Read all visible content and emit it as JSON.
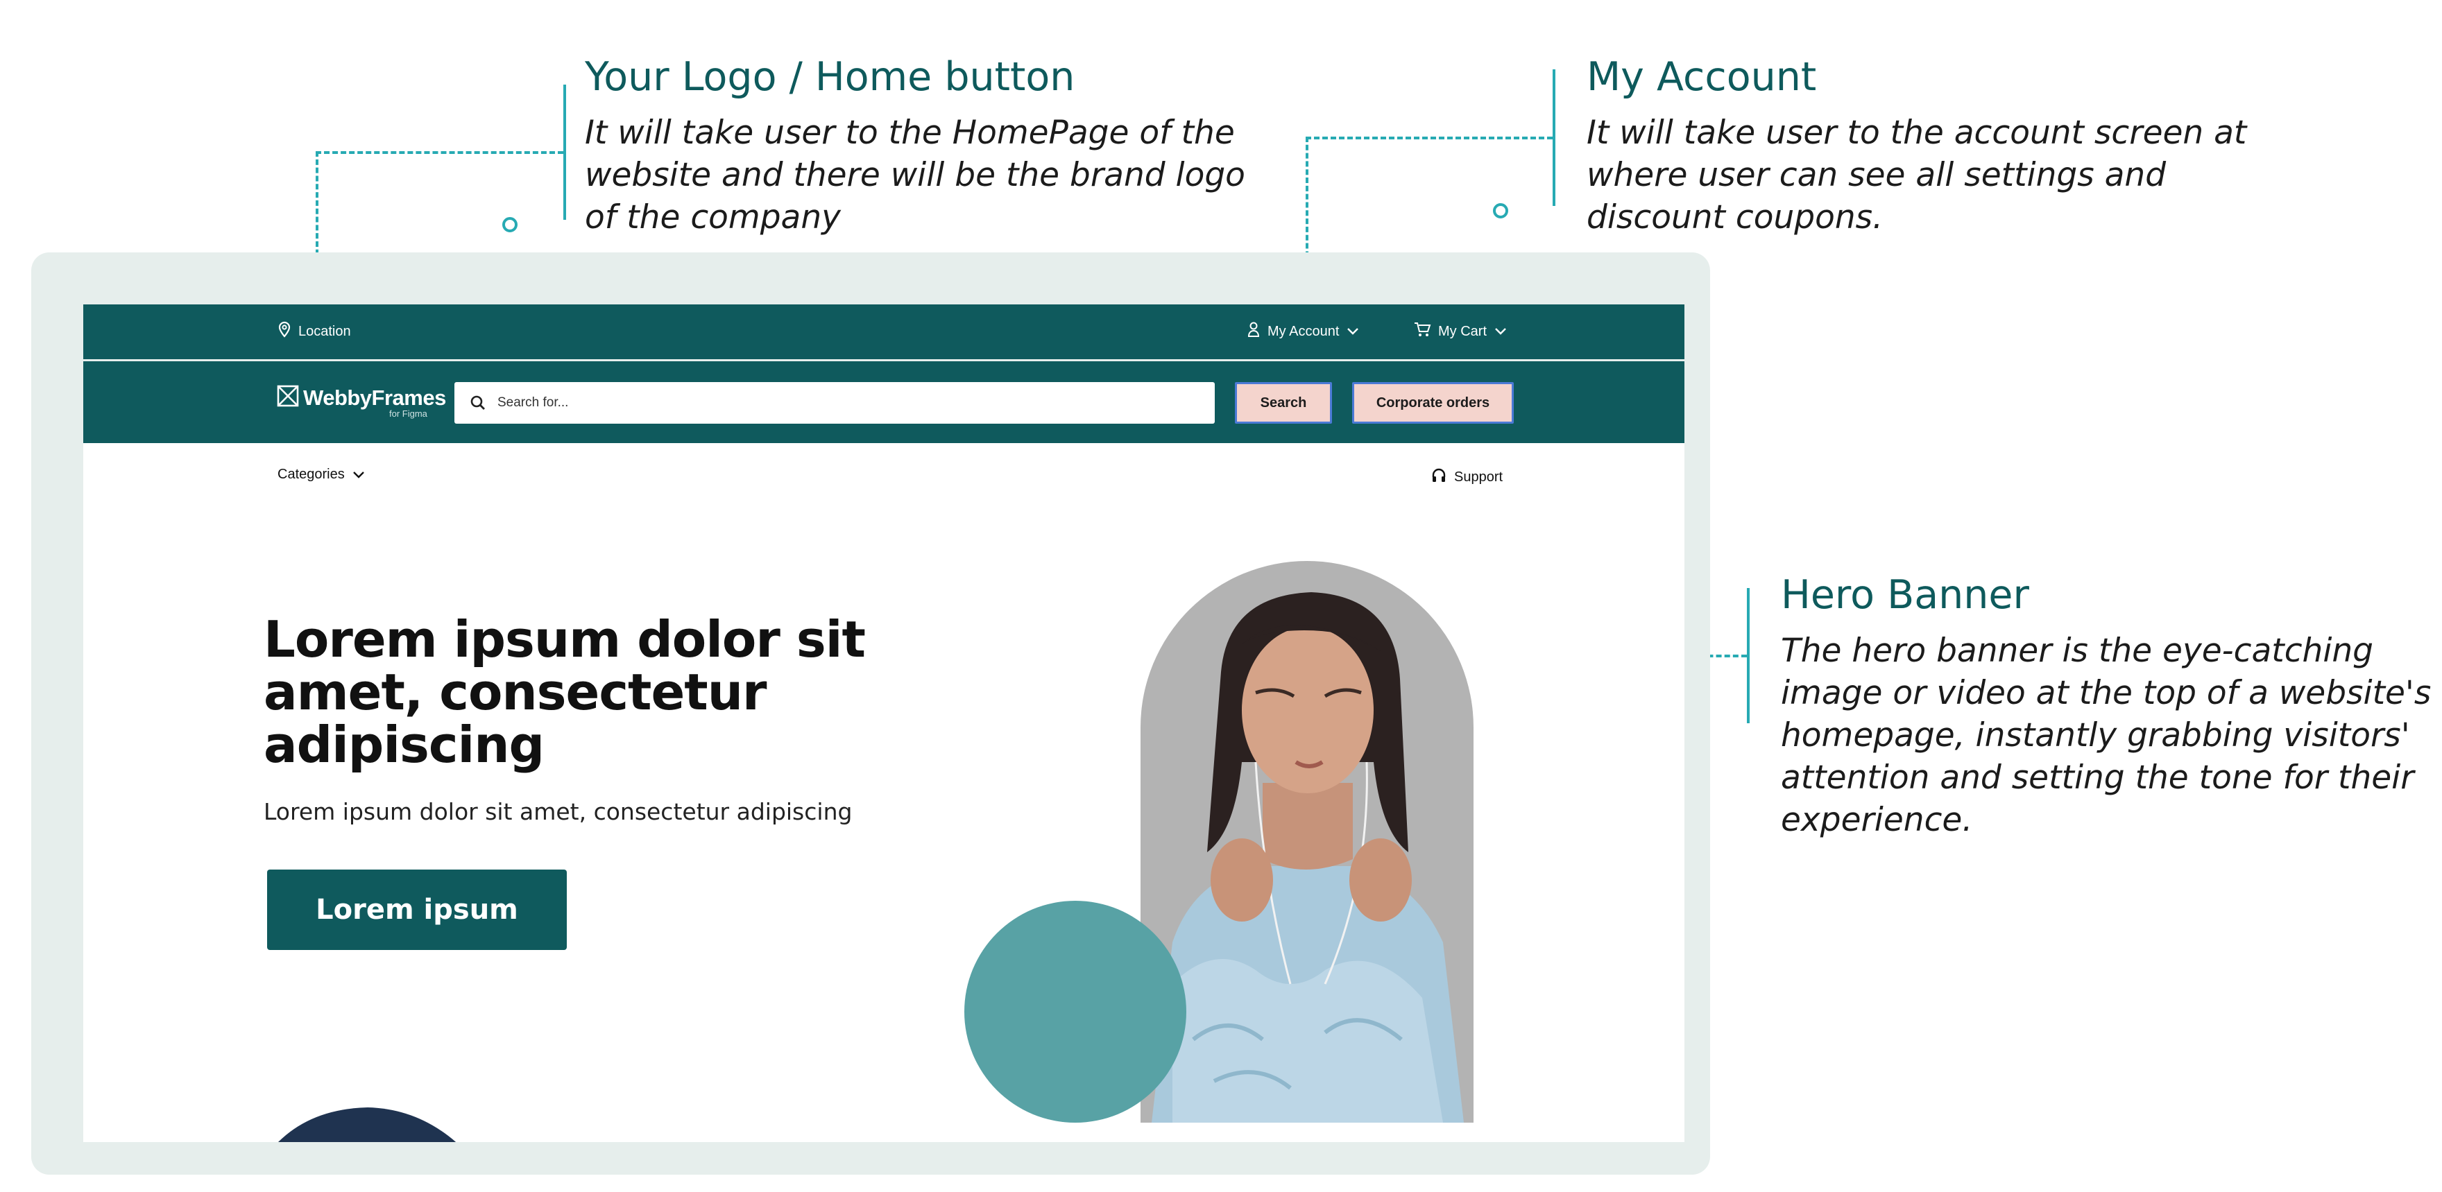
{
  "annotations": {
    "logo": {
      "title": "Your Logo / Home button",
      "lines": [
        "It will take user to the HomePage of the",
        "website and there will be the brand logo",
        "of the company"
      ]
    },
    "account": {
      "title": "My Account",
      "lines": [
        "It will take user to the account screen at",
        "where user can see all settings and",
        "discount coupons."
      ]
    },
    "hero": {
      "title": "Hero Banner",
      "lines": [
        "The hero banner is the eye-catching",
        "image or video at the top of a website's",
        "homepage, instantly grabbing visitors'",
        "attention and setting the tone for their",
        "experience."
      ]
    }
  },
  "topbar": {
    "location_label": "Location",
    "account_label": "My Account",
    "cart_label": "My Cart"
  },
  "header": {
    "logo_name": "WebbyFrames",
    "logo_sub": "for Figma",
    "search_placeholder": "Search for...",
    "search_button": "Search",
    "corporate_button": "Corporate orders"
  },
  "subnav": {
    "categories_label": "Categories",
    "support_label": "Support"
  },
  "hero": {
    "title": "Lorem ipsum dolor sit amet, consectetur adipiscing",
    "subtitle": "Lorem ipsum dolor sit amet, consectetur adipiscing",
    "cta": "Lorem ipsum"
  },
  "colors": {
    "brand": "#0f5a5d",
    "accent": "#27aab3",
    "button_pink": "#f4d4cd",
    "circle_teal": "#58a2a5",
    "arch_gray": "#b3b3b3"
  },
  "icons": [
    "location-pin-icon",
    "user-icon",
    "cart-icon",
    "chevron-down-icon",
    "search-icon",
    "logo-icon",
    "headphones-icon"
  ]
}
